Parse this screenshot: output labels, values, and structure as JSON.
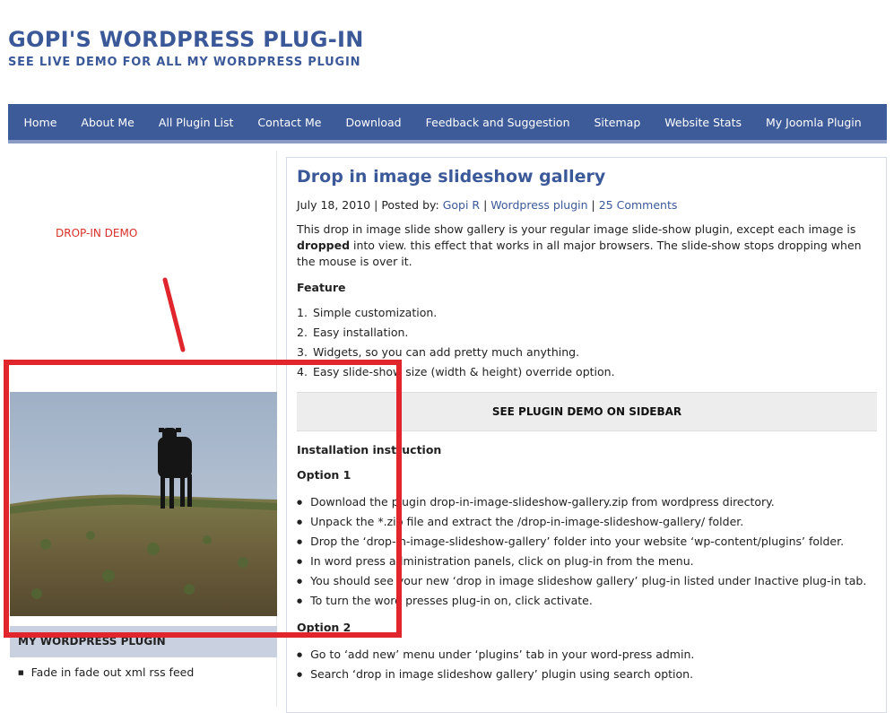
{
  "header": {
    "title": "GOPI'S WORDPRESS PLUG-IN",
    "tagline": "SEE LIVE DEMO FOR ALL MY WORDPRESS PLUGIN"
  },
  "nav": {
    "items": [
      "Home",
      "About Me",
      "All Plugin List",
      "Contact Me",
      "Download",
      "Feedback and Suggestion",
      "Sitemap",
      "Website Stats",
      "My Joomla Plugin"
    ]
  },
  "sidebar": {
    "demo_label": "DROP-IN DEMO",
    "widget_title": "MY WORDPRESS PLUGIN",
    "widget_items": [
      "Fade in fade out xml rss feed"
    ]
  },
  "post": {
    "title": "Drop in image slideshow gallery",
    "meta": {
      "date": "July 18, 2010",
      "posted_by_label": "Posted by:",
      "author": "Gopi R",
      "category": "Wordpress plugin",
      "comments": "25 Comments",
      "separator": "|"
    },
    "intro_1": "This drop in image slide show gallery is your regular image slide-show plugin, except each image is ",
    "intro_bold": "dropped",
    "intro_2": " into view. this effect that works in all major browsers. The slide-show stops dropping when the mouse is over it.",
    "feature_heading": "Feature",
    "features": [
      "Simple customization.",
      "Easy installation.",
      "Widgets, so you can add pretty much anything.",
      "Easy slide-show size (width & height) override option."
    ],
    "demo_banner": "SEE PLUGIN DEMO ON SIDEBAR",
    "install_heading": "Installation instruction",
    "option1_heading": "Option 1",
    "option1_items": [
      "Download the plugin drop-in-image-slideshow-gallery.zip from wordpress directory.",
      "Unpack the *.zip file and extract the /drop-in-image-slideshow-gallery/ folder.",
      "Drop the ‘drop-in-image-slideshow-gallery’ folder into your website ‘wp-content/plugins’ folder.",
      "In word press administration panels, click on plug-in from the menu.",
      "You should see your new ‘drop in image slideshow gallery’ plug-in listed under Inactive plug-in tab.",
      "To turn the word presses plug-in on, click activate."
    ],
    "option2_heading": "Option 2",
    "option2_items": [
      "Go to ‘add new’ menu under ‘plugins’ tab in your word-press admin.",
      "Search ‘drop in image slideshow gallery’ plugin using search option."
    ]
  },
  "colors": {
    "brand_blue": "#3b5998",
    "nav_bg": "#3d5a99",
    "annotation_red": "#e0262c",
    "demo_label_red": "#d9302a"
  }
}
